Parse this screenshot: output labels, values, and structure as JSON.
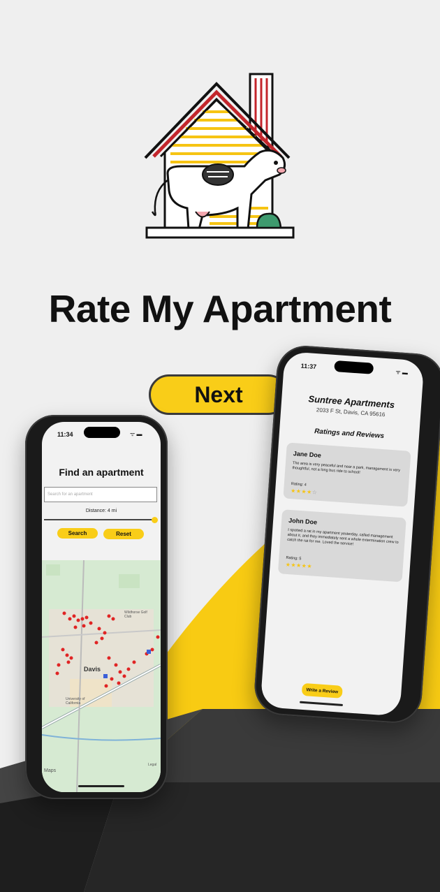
{
  "app_title": "Rate My Apartment",
  "next_label": "Next",
  "colors": {
    "accent": "#f9cd18",
    "background": "#efefef",
    "phone": "#1a1a1a"
  },
  "left_phone": {
    "time": "11:34",
    "title": "Find an apartment",
    "search_placeholder": "Search for an apartment",
    "distance_label": "Distance: 4 mi",
    "slider_level": 1.0,
    "search_button": "Search",
    "reset_button": "Reset",
    "map": {
      "city_label": "Davis",
      "poi_university": "University of California",
      "poi_golf": "Wildhorse Golf Club",
      "maps_watermark": "Maps",
      "legal": "Legal"
    }
  },
  "right_phone": {
    "time": "11:37",
    "apartment_name": "Suntree Apartments",
    "apartment_address": "2033 F St, Davis, CA 95616",
    "section_title": "Ratings and Reviews",
    "reviews": [
      {
        "name": "Jane Doe",
        "text": "The area is very peaceful and near a park, management is very thoughtful, not a long bus ride to school!",
        "rating_label": "Rating: 4",
        "rating": 4
      },
      {
        "name": "John Doe",
        "text": "I spotted a rat in my apartment yesterday, called management about it, and they immediately sent a whole extermination crew to catch the rat for me. Loved the service!",
        "rating_label": "Rating: 5",
        "rating": 5
      }
    ],
    "write_review_button": "Write a Review"
  }
}
